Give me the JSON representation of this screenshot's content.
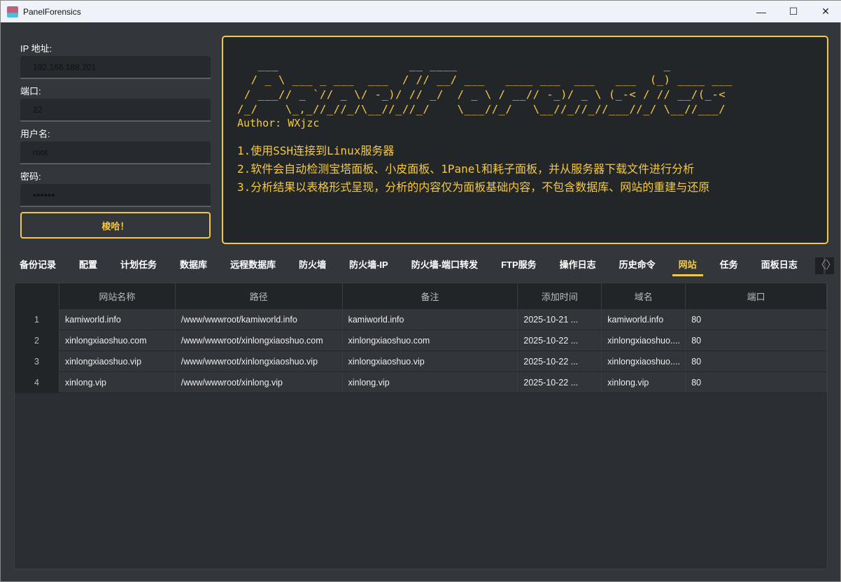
{
  "window": {
    "title": "PanelForensics",
    "minimize": "—",
    "maximize": "☐",
    "close": "✕"
  },
  "form": {
    "ip_label": "IP 地址:",
    "ip_value": "192.168.188.201",
    "port_label": "端口:",
    "port_value": "22",
    "user_label": "用户名:",
    "user_value": "root",
    "password_label": "密码:",
    "password_value": "••••••",
    "submit_label": "梭哈！"
  },
  "banner": {
    "ascii": "   ___                   __ ____                              _\n  / _ \\ ___ _ ___  ___  / // __/ ___   ____ ___  ___   ___  (_) ____ ___\n / ___// _ `// _ \\/ -_)/ // _/  / _ \\ / __// -_)/ _ \\ (_-< / // __/(_-<\n/_/    \\_,_//_//_/\\__//_//_/    \\___//_/   \\__//_//_//___//_/ \\__//___/",
    "author": "Author: WXjzc",
    "lines": [
      "1.使用SSH连接到Linux服务器",
      "2.软件会自动检测宝塔面板、小皮面板、1Panel和耗子面板，并从服务器下载文件进行分析",
      "3.分析结果以表格形式呈现，分析的内容仅为面板基础内容，不包含数据库、网站的重建与还原"
    ]
  },
  "tabs": [
    "备份记录",
    "配置",
    "计划任务",
    "数据库",
    "远程数据库",
    "防火墙",
    "防火墙-IP",
    "防火墙-端口转发",
    "FTP服务",
    "操作日志",
    "历史命令",
    "网站",
    "任务",
    "面板日志"
  ],
  "active_tab": "网站",
  "table": {
    "columns": [
      "网站名称",
      "路径",
      "备注",
      "添加时间",
      "域名",
      "端口"
    ],
    "rows": [
      [
        "1",
        "kamiworld.info",
        "/www/wwwroot/kamiworld.info",
        "kamiworld.info",
        "2025-10-21 ...",
        "kamiworld.info",
        "80"
      ],
      [
        "2",
        "xinlongxiaoshuo.com",
        "/www/wwwroot/xinlongxiaoshuo.com",
        "xinlongxiaoshuo.com",
        "2025-10-22 ...",
        "xinlongxiaoshuo....",
        "80"
      ],
      [
        "3",
        "xinlongxiaoshuo.vip",
        "/www/wwwroot/xinlongxiaoshuo.vip",
        "xinlongxiaoshuo.vip",
        "2025-10-22 ...",
        "xinlongxiaoshuo....",
        "80"
      ],
      [
        "4",
        "xinlong.vip",
        "/www/wwwroot/xinlong.vip",
        "xinlong.vip",
        "2025-10-22 ...",
        "xinlong.vip",
        "80"
      ]
    ]
  },
  "colors": {
    "accent": "#f5c842",
    "background": "#33373c",
    "panel": "#232629"
  }
}
